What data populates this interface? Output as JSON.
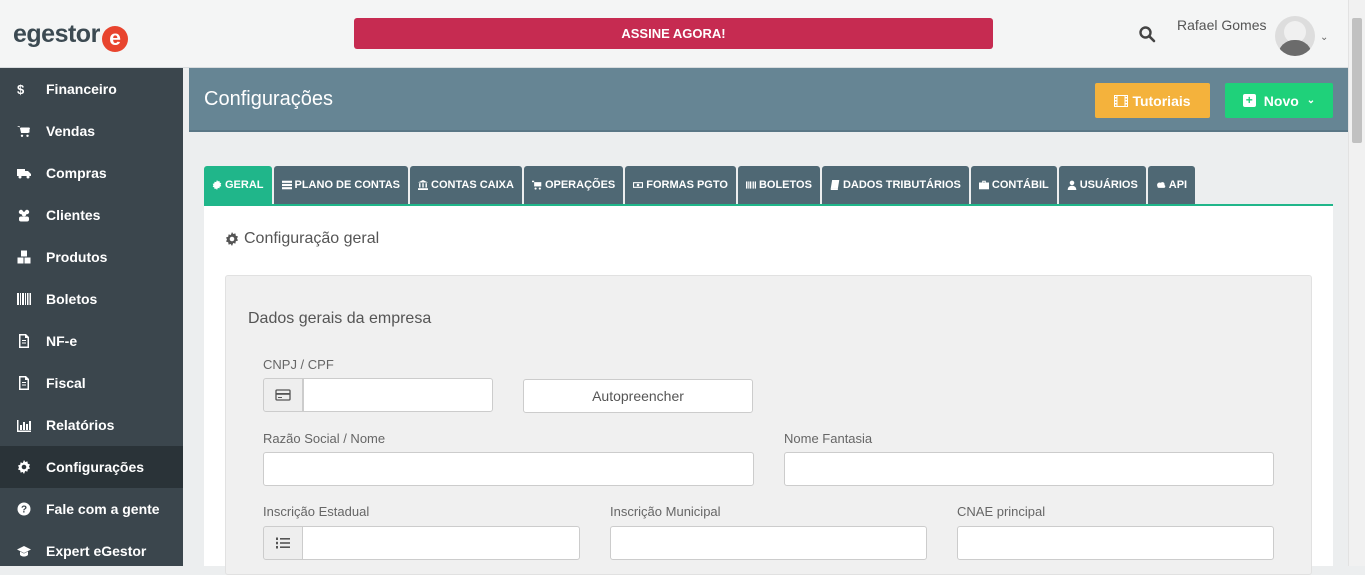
{
  "brand": {
    "name": "egestor",
    "mark": "e"
  },
  "topbar": {
    "subscribe_label": "ASSINE AGORA!",
    "user_name": "Rafael Gomes"
  },
  "sidebar": {
    "items": [
      {
        "label": "Financeiro",
        "icon": "dollar-icon"
      },
      {
        "label": "Vendas",
        "icon": "cart-icon"
      },
      {
        "label": "Compras",
        "icon": "truck-icon"
      },
      {
        "label": "Clientes",
        "icon": "users-icon"
      },
      {
        "label": "Produtos",
        "icon": "cubes-icon"
      },
      {
        "label": "Boletos",
        "icon": "barcode-icon"
      },
      {
        "label": "NF-e",
        "icon": "file-icon"
      },
      {
        "label": "Fiscal",
        "icon": "file-icon"
      },
      {
        "label": "Relatórios",
        "icon": "bar-chart-icon"
      },
      {
        "label": "Configurações",
        "icon": "gear-icon"
      },
      {
        "label": "Fale com a gente",
        "icon": "question-icon"
      },
      {
        "label": "Expert eGestor",
        "icon": "graduation-cap-icon"
      }
    ],
    "active": "Configurações"
  },
  "header": {
    "title": "Configurações",
    "tutorials_label": "Tutoriais",
    "new_label": "Novo"
  },
  "tabs": [
    {
      "label": "GERAL",
      "icon": "gear-icon",
      "active": true
    },
    {
      "label": "PLANO DE CONTAS",
      "icon": "list-icon"
    },
    {
      "label": "CONTAS CAIXA",
      "icon": "bank-icon"
    },
    {
      "label": "OPERAÇÕES",
      "icon": "cart-icon"
    },
    {
      "label": "FORMAS PGTO",
      "icon": "money-icon"
    },
    {
      "label": "BOLETOS",
      "icon": "barcode-icon"
    },
    {
      "label": "DADOS TRIBUTÁRIOS",
      "icon": "book-icon"
    },
    {
      "label": "CONTÁBIL",
      "icon": "briefcase-icon"
    },
    {
      "label": "USUÁRIOS",
      "icon": "user-icon"
    },
    {
      "label": "API",
      "icon": "cloud-icon"
    }
  ],
  "content": {
    "section_title": "Configuração geral",
    "group_title": "Dados gerais da empresa",
    "fields": {
      "cnpj_label": "CNPJ / CPF",
      "cnpj_value": "",
      "autofill_label": "Autopreencher",
      "razao_label": "Razão Social / Nome",
      "razao_value": "",
      "fantasia_label": "Nome Fantasia",
      "fantasia_value": "",
      "ie_label": "Inscrição Estadual",
      "ie_value": "",
      "im_label": "Inscrição Municipal",
      "im_value": "",
      "cnae_label": "CNAE principal",
      "cnae_value": ""
    }
  },
  "colors": {
    "sidebar_bg": "#3b464d",
    "header_bg": "#668594",
    "subscribe_bg": "#c62b51",
    "tab_active": "#20b68a",
    "tab_bg": "#4f6874",
    "tutorials_bg": "#f4b23c",
    "new_bg": "#1fd17a"
  }
}
